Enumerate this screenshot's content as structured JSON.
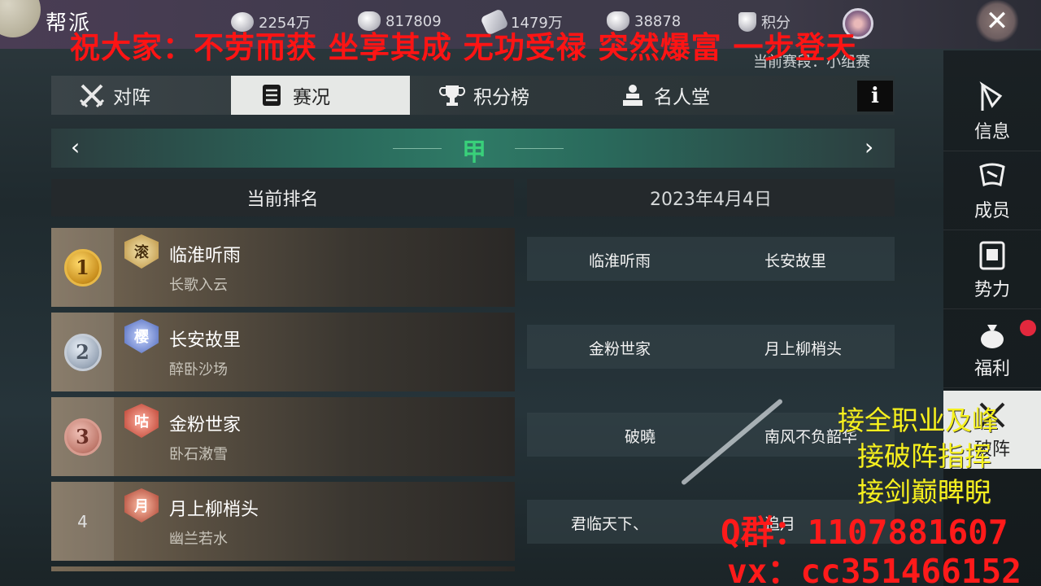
{
  "header": {
    "title": "帮派",
    "resources": [
      {
        "icon": "silver-coin-icon",
        "value": "2254万"
      },
      {
        "icon": "ingot-icon",
        "value": "817809"
      },
      {
        "icon": "jade-icon",
        "value": "1479万"
      },
      {
        "icon": "gold-ingot-icon",
        "value": "38878"
      },
      {
        "icon": "badge-icon",
        "value": "积分"
      }
    ],
    "close_label": "✕"
  },
  "stage_text": "当前赛段：小组赛",
  "tabs": [
    {
      "label": "对阵",
      "icon": "crossed-swords-icon",
      "active": false
    },
    {
      "label": "赛况",
      "icon": "scroll-list-icon",
      "active": true
    },
    {
      "label": "积分榜",
      "icon": "trophy-icon",
      "active": false
    },
    {
      "label": "名人堂",
      "icon": "pagoda-icon",
      "active": false
    }
  ],
  "info_label": "i",
  "division": {
    "name": "甲",
    "prev": "‹",
    "next": "›"
  },
  "ranking_header": "当前排名",
  "date_header": "2023年4月4日",
  "rankings": [
    {
      "rank": "1",
      "guild_badge": "滚",
      "guild": "临淮听雨",
      "leader": "长歌入云"
    },
    {
      "rank": "2",
      "guild_badge": "樱",
      "guild": "长安故里",
      "leader": "醉卧沙场"
    },
    {
      "rank": "3",
      "guild_badge": "咕",
      "guild": "金粉世家",
      "leader": "卧石潄雪"
    },
    {
      "rank": "4",
      "guild_badge": "月",
      "guild": "月上柳梢头",
      "leader": "幽兰若水"
    }
  ],
  "matchups": [
    {
      "left": "临淮听雨",
      "right": "长安故里"
    },
    {
      "left": "金粉世家",
      "right": "月上柳梢头"
    },
    {
      "left": "破曉",
      "right": "南风不负韶华"
    },
    {
      "left": "君临天下、",
      "right": "追月"
    }
  ],
  "sidebar": [
    {
      "label": "信息",
      "icon": "flag-icon"
    },
    {
      "label": "成员",
      "icon": "banner-icon"
    },
    {
      "label": "势力",
      "icon": "seal-icon"
    },
    {
      "label": "福利",
      "icon": "money-bag-icon"
    },
    {
      "label": "破阵",
      "icon": "crossed-swords-icon"
    }
  ],
  "overlay": {
    "banner": "祝大家：不劳而获 坐享其成 无功受禄 突然爆富 一步登天",
    "ads": [
      "接全职业及峰",
      "接破阵指挥",
      "接剑巅睥睨"
    ],
    "qq": "Q群：1107881607",
    "vx": "vx：cc351466152"
  },
  "colors": {
    "banner": "#ff1414",
    "ads": "#f5f01e",
    "division": "#39d07a",
    "tab_active": "#e6e8e6"
  }
}
